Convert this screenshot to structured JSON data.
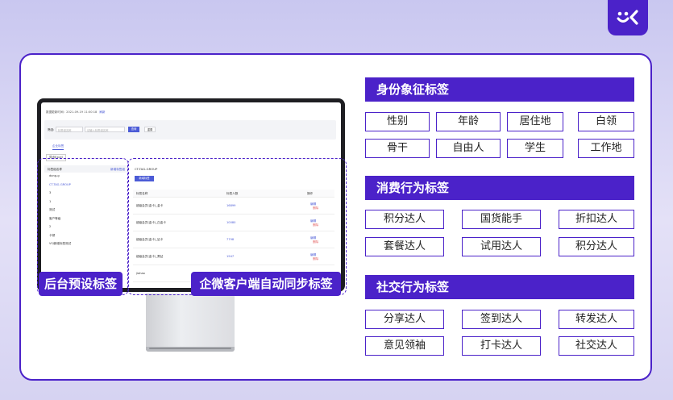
{
  "screen": {
    "update_time": "数据更新时间：2021-09-19 11:00:18",
    "refresh_link": "刷新",
    "filter_label": "筛选:",
    "filter_placeholder_1": "标签组名称",
    "filter_placeholder_2": "请输入标签组名称",
    "query_button": "查询",
    "reset_button": "重置",
    "tab_label": "企业标签",
    "export_button": "导出Excel",
    "left_header": "标签组名称",
    "left_add": "新增标签组",
    "left_items": [
      "dong-g",
      "CT-TAG-GROUP",
      "3",
      "1",
      "测试",
      "客户等级",
      "2",
      "卡顿",
      "VYJ新增标签测试"
    ],
    "right_title": "CT-TAG-GROUP",
    "new_tag_button": "新增标签",
    "table_headers": [
      "标签名称",
      "标签人数",
      "操作"
    ],
    "rows": [
      {
        "name": "超级会员(金卡)_金卡",
        "count": "16899"
      },
      {
        "name": "超级会员(金卡)_白金卡",
        "count": "10080"
      },
      {
        "name": "超级会员(金卡)_钻卡",
        "count": "7798"
      },
      {
        "name": "超级会员(金卡)_黑钻",
        "count": "1947"
      },
      {
        "name": "jiahao",
        "count": ""
      }
    ],
    "op_edit": "编辑",
    "op_delete": "删除"
  },
  "badges": {
    "left": "后台预设标签",
    "right": "企微客户端自动同步标签"
  },
  "sections": [
    {
      "title": "身份象征标签",
      "tags": [
        "性别",
        "年龄",
        "居住地",
        "白领",
        "骨干",
        "自由人",
        "学生",
        "工作地"
      ]
    },
    {
      "title": "消费行为标签",
      "tags": [
        "积分达人",
        "国货能手",
        "折扣达人",
        "套餐达人",
        "试用达人",
        "积分达人"
      ]
    },
    {
      "title": "社交行为标签",
      "tags": [
        "分享达人",
        "签到达人",
        "转发达人",
        "意见领袖",
        "打卡达人",
        "社交达人"
      ]
    }
  ],
  "colors": {
    "accent": "#4b22c9",
    "link": "#4b5bd6"
  },
  "icons": {
    "logo": "brand-logo-icon"
  }
}
